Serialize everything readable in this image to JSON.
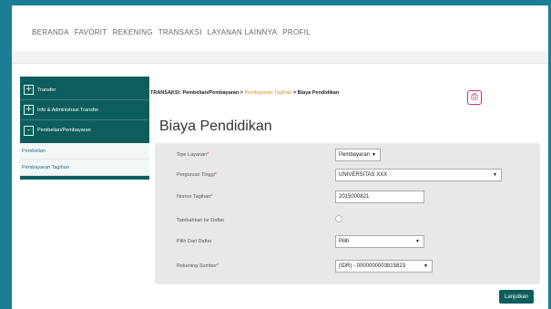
{
  "nav": {
    "items": [
      "BERANDA",
      "FAVORIT",
      "REKENING",
      "TRANSAKSI",
      "LAYANAN LAINNYA",
      "PROFIL"
    ]
  },
  "sidebar": {
    "items": [
      {
        "label": "Transfer",
        "icon": "+"
      },
      {
        "label": "Info & Administrasi Transfer",
        "icon": "+"
      },
      {
        "label": "Pembelian/Pembayaran",
        "icon": "-"
      }
    ],
    "subitems": [
      "Pembelian",
      "Pembayaran Tagihan"
    ]
  },
  "breadcrumb": {
    "section": "TRANSAKSI: Pembelian/Pembayaran",
    "link": "Pembayaran Tagihan",
    "current": "Biaya Pendidikan",
    "sep": " > "
  },
  "page": {
    "title": "Biaya Pendidikan"
  },
  "form": {
    "tipe_layanan": {
      "label": "Tipe Layanan",
      "value": "Pembayaran"
    },
    "perguruan_tinggi": {
      "label": "Perguruan Tinggi",
      "value": "UNIVERSITAS XXX"
    },
    "nomor_tagihan": {
      "label": "Nomor Tagihan",
      "value": "2015000821"
    },
    "tambahkan_daftar": {
      "label": "Tambahkan ke Daftar"
    },
    "pilih_daftar": {
      "label": "Pilih Dari Daftar",
      "value": "Pilih"
    },
    "rekening_sumber": {
      "label": "Rekening Sumber",
      "value": "(IDR) - 0000000003815823"
    },
    "required_mark": "*"
  },
  "actions": {
    "submit_label": "Lanjutkan"
  }
}
